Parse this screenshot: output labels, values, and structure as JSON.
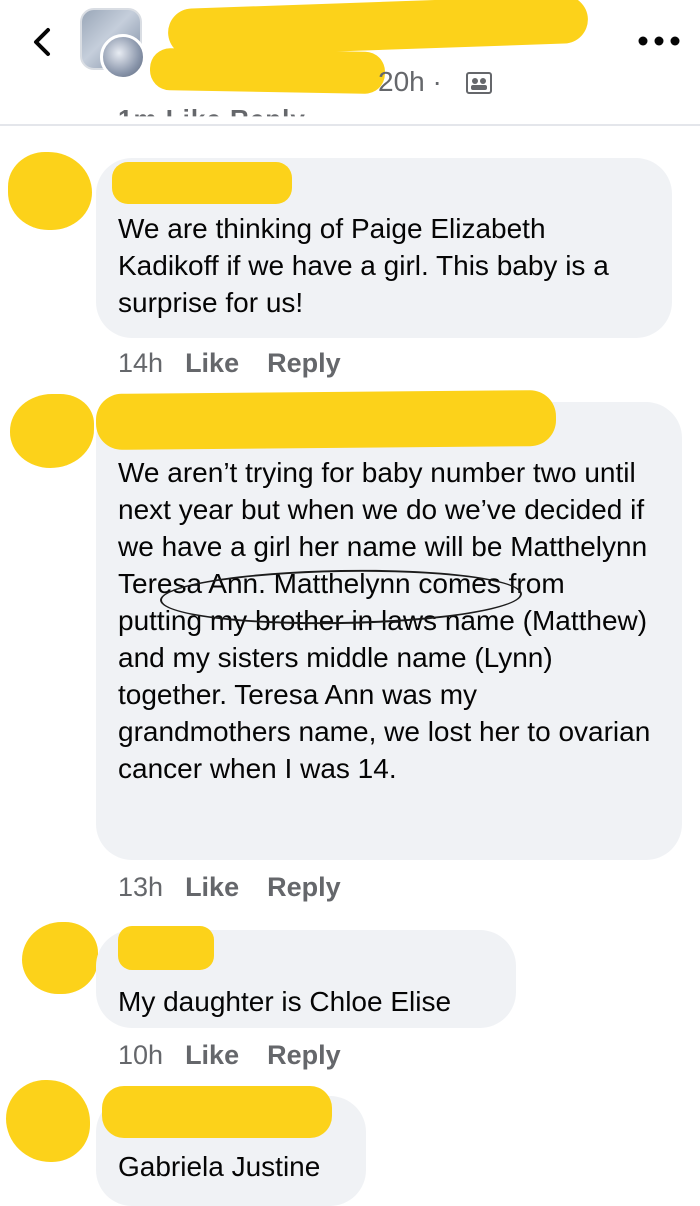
{
  "header": {
    "time": "20h ·",
    "back_icon": "chevron-left-icon",
    "more_icon": "more-horizontal-icon",
    "audience_icon": "friends-audience-icon",
    "cutoff_actions": "1m   Like   Reply"
  },
  "colors": {
    "redaction": "#fcd21a",
    "bubble": "#f0f2f5",
    "meta": "#65676b",
    "text": "#050505"
  },
  "comments": [
    {
      "text": "We are thinking of Paige Elizabeth Kadikoff if we have a girl. This baby is a surprise for us!",
      "time": "14h",
      "like": "Like",
      "reply": "Reply"
    },
    {
      "text": "We aren’t trying for baby number two until next year but when we do we’ve decided if we have a girl her name will be Matthelynn Teresa Ann. Matthelynn comes from putting my brother in laws name (Matthew) and my sisters middle name (Lynn) together. Teresa Ann was my grandmothers name, we lost her to ovarian cancer when I was 14.",
      "time": "13h",
      "like": "Like",
      "reply": "Reply"
    },
    {
      "text": "My daughter is Chloe Elise",
      "time": "10h",
      "like": "Like",
      "reply": "Reply"
    },
    {
      "text": "Gabriela Justine"
    }
  ]
}
